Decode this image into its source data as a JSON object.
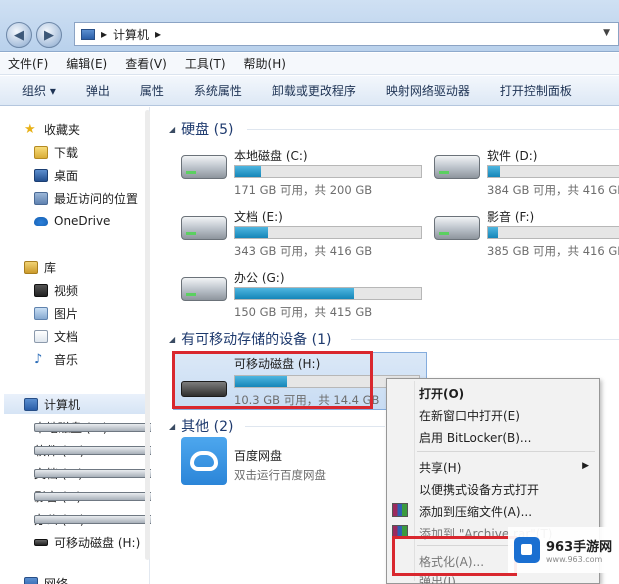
{
  "address": {
    "crumb_sep": "▸",
    "location": "计算机",
    "crumb_sep2": "▸"
  },
  "menu": [
    "文件(F)",
    "编辑(E)",
    "查看(V)",
    "工具(T)",
    "帮助(H)"
  ],
  "toolbar": [
    "组织 ▾",
    "弹出",
    "属性",
    "系统属性",
    "卸载或更改程序",
    "映射网络驱动器",
    "打开控制面板"
  ],
  "sidebar": {
    "favorites": "收藏夹",
    "downloads": "下载",
    "desktop": "桌面",
    "recent": "最近访问的位置",
    "onedrive": "OneDrive",
    "libraries": "库",
    "videos": "视频",
    "pictures": "图片",
    "documents": "文档",
    "music": "音乐",
    "computer": "计算机",
    "drives": [
      "本地磁盘 (C:)",
      "软件 (D:)",
      "文档 (E:)",
      "影音 (F:)",
      "办公 (G:)",
      "可移动磁盘 (H:)"
    ],
    "network": "网络"
  },
  "groups": {
    "hdd": "硬盘 (5)",
    "removable": "有可移动存储的设备 (1)",
    "other": "其他 (2)"
  },
  "drives": [
    {
      "name": "本地磁盘 (C:)",
      "info": "171 GB 可用，共 200 GB",
      "used_pct": 14
    },
    {
      "name": "软件 (D:)",
      "info": "384 GB 可用，共 416 GB",
      "used_pct": 8
    },
    {
      "name": "文档 (E:)",
      "info": "343 GB 可用，共 416 GB",
      "used_pct": 18
    },
    {
      "name": "影音 (F:)",
      "info": "385 GB 可用，共 416 GB",
      "used_pct": 7
    },
    {
      "name": "办公 (G:)",
      "info": "150 GB 可用，共 415 GB",
      "used_pct": 64
    }
  ],
  "removable_drive": {
    "name": "可移动磁盘 (H:)",
    "info": "10.3 GB 可用，共 14.4 GB",
    "used_pct": 28
  },
  "other_item": {
    "name": "百度网盘",
    "desc": "双击运行百度网盘"
  },
  "context_menu": {
    "open": "打开(O)",
    "open_new": "在新窗口中打开(E)",
    "bitlocker": "启用 BitLocker(B)...",
    "share": "共享(H)",
    "portable": "以便携式设备方式打开",
    "add_archive": "添加到压缩文件(A)...",
    "add_named": "添加到 \"Archive.rar\"(T)",
    "format": "格式化(A)...",
    "eject": "弹出(J)"
  },
  "watermark": {
    "title": "963手游网",
    "url": "www.963.com"
  }
}
